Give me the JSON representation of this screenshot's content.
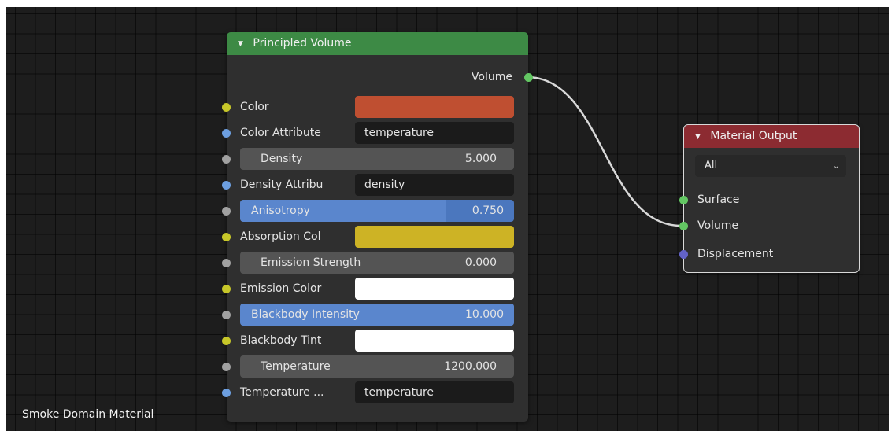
{
  "caption": "Smoke Domain Material",
  "principled_volume": {
    "title": "Principled Volume",
    "output_label": "Volume",
    "rows": {
      "color": {
        "label": "Color",
        "swatch": "#bf4f31"
      },
      "color_attribute": {
        "label": "Color Attribute",
        "value": "temperature"
      },
      "density": {
        "label": "Density",
        "value": "5.000"
      },
      "density_attribute": {
        "label": "Density Attribu",
        "value": "density"
      },
      "anisotropy": {
        "label": "Anisotropy",
        "value": "0.750",
        "fraction": 0.75
      },
      "absorption_color": {
        "label": "Absorption Col",
        "swatch": "#cdb325"
      },
      "emission_strength": {
        "label": "Emission Strength",
        "value": "0.000"
      },
      "emission_color": {
        "label": "Emission Color",
        "swatch": "#ffffff"
      },
      "blackbody_intensity": {
        "label": "Blackbody Intensity",
        "value": "10.000",
        "fraction": 1.0
      },
      "blackbody_tint": {
        "label": "Blackbody Tint",
        "swatch": "#ffffff"
      },
      "temperature": {
        "label": "Temperature",
        "value": "1200.000"
      },
      "temperature_attribute": {
        "label": "Temperature ...",
        "value": "temperature"
      }
    }
  },
  "material_output": {
    "title": "Material Output",
    "target": "All",
    "inputs": {
      "surface": "Surface",
      "volume": "Volume",
      "displacement": "Displacement"
    }
  },
  "colors": {
    "principled_header": "#3d8a45",
    "output_header": "#8c2b31",
    "socket_color": "#c7c729",
    "socket_vector": "#6d9fe0",
    "socket_float": "#a1a1a1",
    "socket_shader": "#63c763",
    "socket_displacement": "#6363c7",
    "link": "#d8d8d8"
  }
}
